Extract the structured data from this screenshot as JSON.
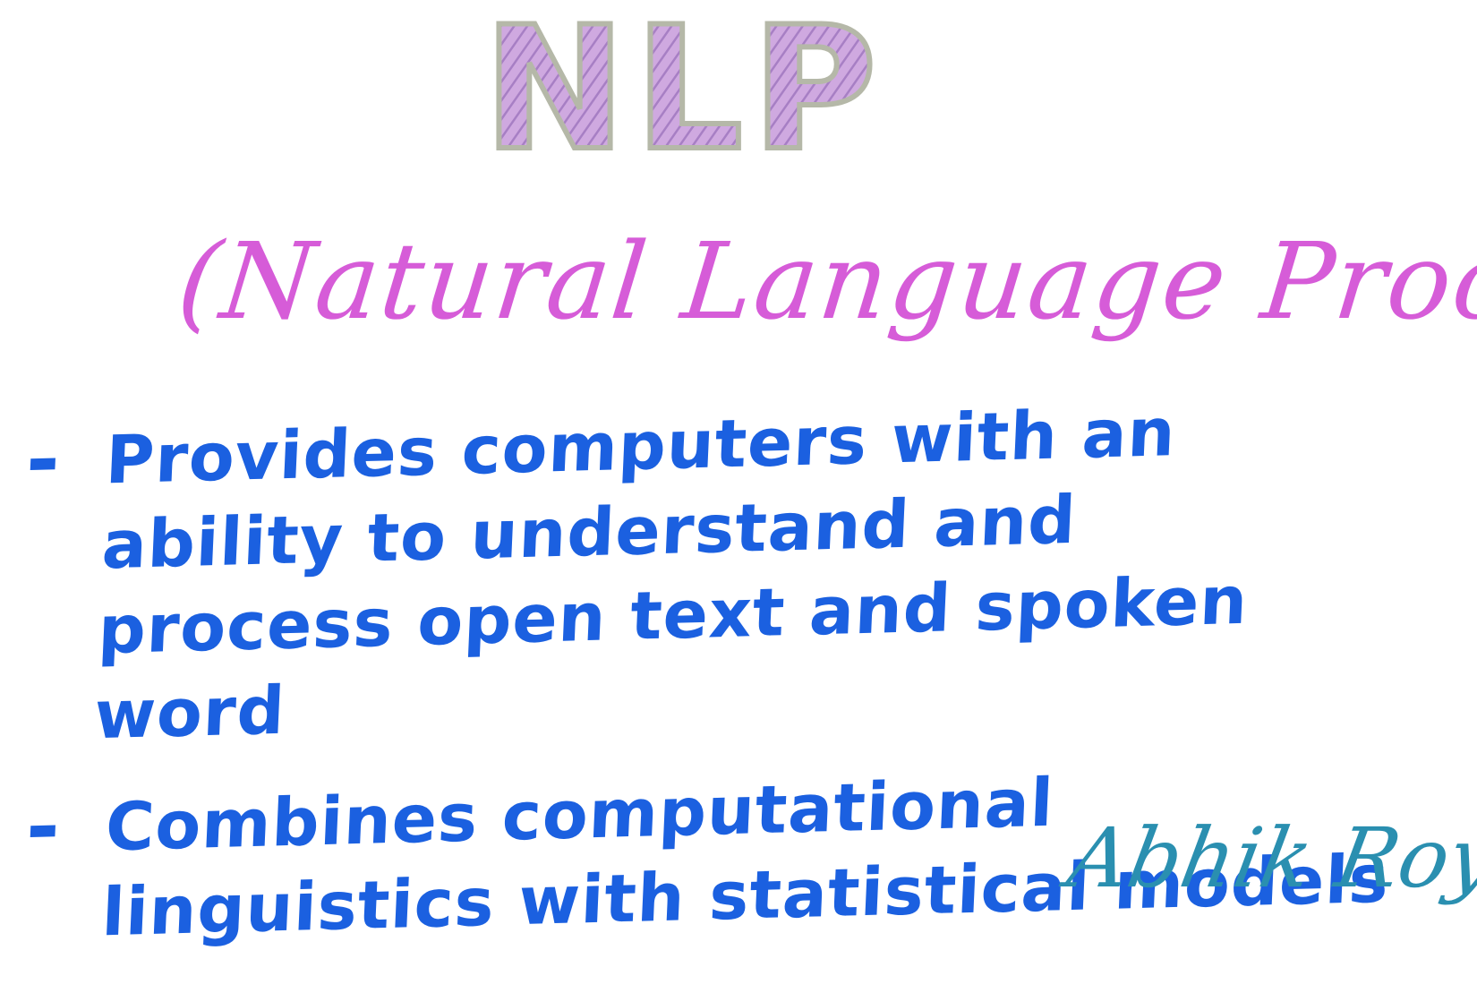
{
  "title": "NLP",
  "subtitle": "(Natural Language Processing)",
  "bullets": [
    {
      "marker": "-",
      "text": "Provides computers with an ability to understand and process open text and spoken word"
    },
    {
      "marker": "-",
      "text": "Combines computational linguistics with statistical models"
    }
  ],
  "signature": "Abhik Roy",
  "colors": {
    "title_fill": "#c39ad6",
    "title_outline": "#b5b8a8",
    "subtitle": "#d65cd8",
    "bullets": "#1b60e0",
    "signature": "#2a8fb0"
  }
}
